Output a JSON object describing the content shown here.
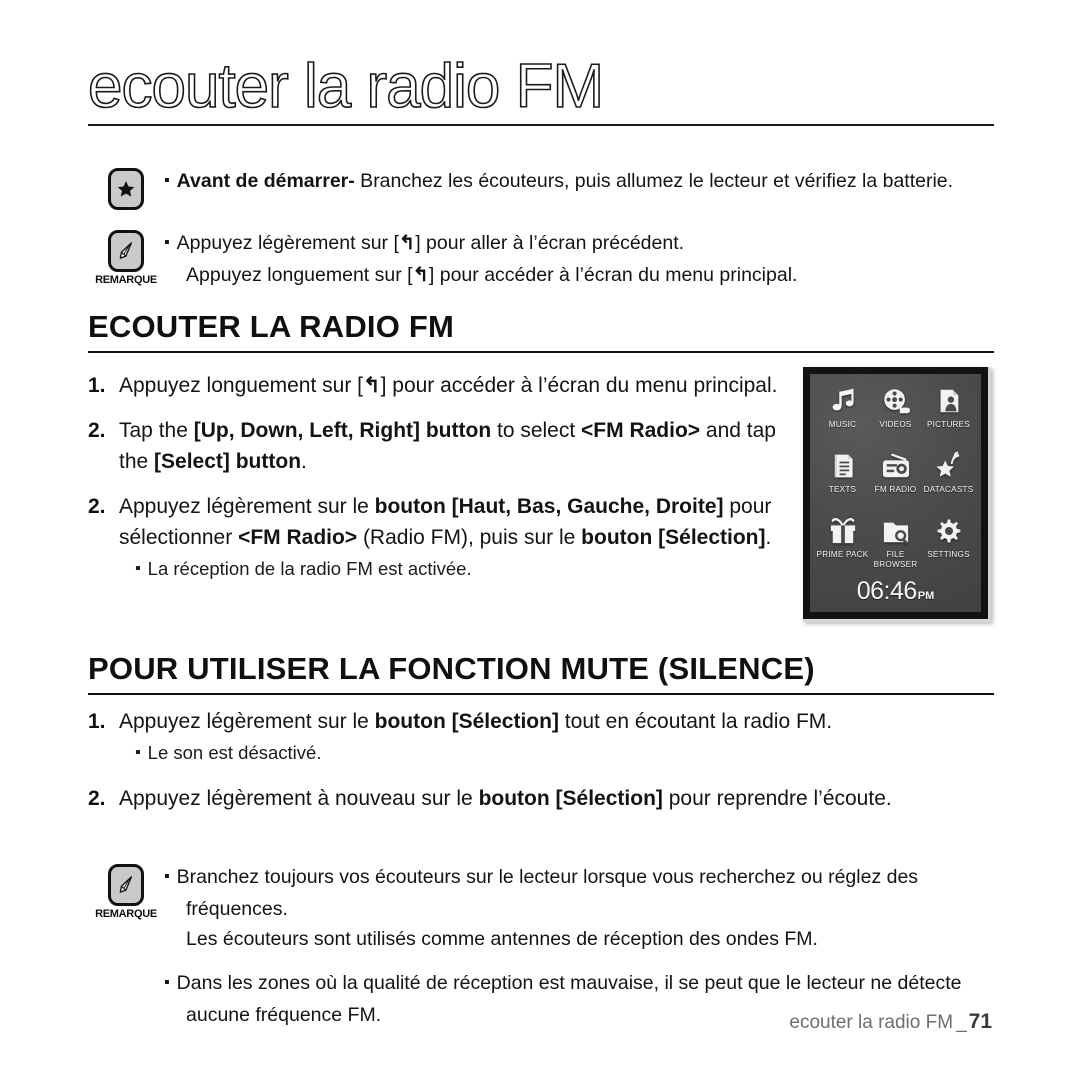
{
  "title": "ecouter la radio FM",
  "notes_top": {
    "star_note": {
      "icon": "star-badge-icon",
      "bold_lead": "Avant de démarrer-",
      "text": " Branchez les écouteurs, puis allumez le lecteur et vérifiez la batterie."
    },
    "remarque_note": {
      "icon": "remarque-pencil-icon",
      "label": "REMARQUE",
      "line1_a": "Appuyez légèrement sur [",
      "line1_b": "] pour aller à l’écran précédent.",
      "line2_a": "Appuyez longuement sur [",
      "line2_b": "] pour accéder à l’écran du menu principal.",
      "back_glyph": "↰"
    }
  },
  "section1": {
    "heading": "ECOUTER LA RADIO FM",
    "steps": [
      {
        "num": "1.",
        "parts": [
          {
            "t": "Appuyez longuement sur [",
            "b": false
          },
          {
            "t": "↰",
            "b": false,
            "glyph": true
          },
          {
            "t": "] pour accéder à l’écran du menu principal.",
            "b": false
          }
        ]
      },
      {
        "num": "2.",
        "parts": [
          {
            "t": "Tap the ",
            "b": false
          },
          {
            "t": "[Up, Down, Left, Right] button",
            "b": true
          },
          {
            "t": " to select ",
            "b": false
          },
          {
            "t": "<FM Radio>",
            "b": true
          },
          {
            "t": " and tap the ",
            "b": false
          },
          {
            "t": "[Select] button",
            "b": true
          },
          {
            "t": ".",
            "b": false
          }
        ]
      },
      {
        "num": "2.",
        "parts": [
          {
            "t": "Appuyez légèrement sur le ",
            "b": false
          },
          {
            "t": "bouton [Haut, Bas, Gauche, Droite]",
            "b": true
          },
          {
            "t": " pour sélectionner ",
            "b": false
          },
          {
            "t": "<FM Radio>",
            "b": true
          },
          {
            "t": " (Radio FM), puis sur le ",
            "b": false
          },
          {
            "t": "bouton [Sélection]",
            "b": true
          },
          {
            "t": ".",
            "b": false
          }
        ],
        "sub": "La réception de la radio FM est activée."
      }
    ]
  },
  "section2": {
    "heading": "POUR UTILISER LA FONCTION MUTE (SILENCE)",
    "steps": [
      {
        "num": "1.",
        "parts": [
          {
            "t": "Appuyez légèrement sur le ",
            "b": false
          },
          {
            "t": "bouton [Sélection]",
            "b": true
          },
          {
            "t": " tout en écoutant la radio FM.",
            "b": false
          }
        ],
        "sub": "Le son est désactivé."
      },
      {
        "num": "2.",
        "parts": [
          {
            "t": "Appuyez légèrement à nouveau sur le ",
            "b": false
          },
          {
            "t": "bouton [Sélection]",
            "b": true
          },
          {
            "t": " pour reprendre l’écoute.",
            "b": false
          }
        ]
      }
    ]
  },
  "notes_bottom": {
    "label": "REMARQUE",
    "bullet1_line1": "Branchez toujours vos écouteurs sur le lecteur lorsque vous recherchez ou réglez des fréquences.",
    "bullet1_line2": "Les écouteurs sont utilisés comme antennes de réception des ondes FM.",
    "bullet2": "Dans les zones où la qualité de réception est mauvaise, il se peut que le lecteur ne détecte aucune fréquence FM."
  },
  "device": {
    "menu": [
      {
        "icon": "music-note-icon",
        "label": "MUSIC"
      },
      {
        "icon": "film-reel-icon",
        "label": "VIDEOS"
      },
      {
        "icon": "picture-portrait-icon",
        "label": "PICTURES"
      },
      {
        "icon": "text-document-icon",
        "label": "TEXTS"
      },
      {
        "icon": "fm-radio-icon",
        "label": "FM RADIO"
      },
      {
        "icon": "star-broadcast-icon",
        "label": "DATACASTS"
      },
      {
        "icon": "gift-box-icon",
        "label": "PRIME PACK"
      },
      {
        "icon": "folder-search-icon",
        "label": "FILE BROWSER"
      },
      {
        "icon": "gear-icon",
        "label": "SETTINGS"
      }
    ],
    "clock_time": "06:46",
    "clock_ampm": "PM",
    "screen_color": "#4c4c4c",
    "bezel_color": "#111213"
  },
  "footer": {
    "text": "ecouter la radio FM",
    "separator": "_",
    "page": "71"
  }
}
